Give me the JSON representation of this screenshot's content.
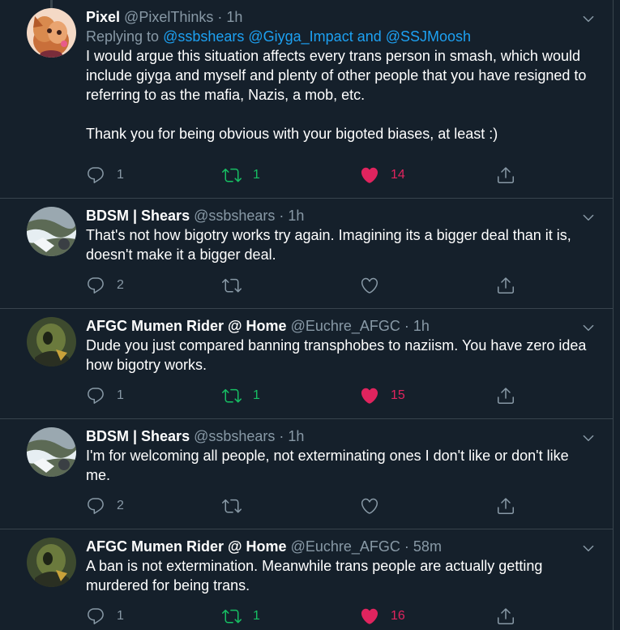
{
  "tweets": [
    {
      "name": "Pixel",
      "handle": "@PixelThinks",
      "time": "1h",
      "replying_prefix": "Replying to ",
      "replying_mentions": "@ssbshears @Giyga_Impact and @SSJMoosh",
      "text": "I would argue this situation affects every trans person in smash, which would include giyga and myself and plenty of other people that you have resigned to referring to as the mafia, Nazis, a mob, etc.\n\nThank you for being obvious with your bigoted biases, at least :)",
      "replies": "1",
      "retweets": "1",
      "retweeted": true,
      "likes": "14",
      "liked": true
    },
    {
      "name": "BDSM | Shears",
      "handle": "@ssbshears",
      "time": "1h",
      "text": "That's not how bigotry works try again. Imagining its a bigger deal than it is, doesn't make it a bigger deal.",
      "replies": "2",
      "retweets": "",
      "retweeted": false,
      "likes": "",
      "liked": false
    },
    {
      "name": "AFGC Mumen Rider @ Home",
      "handle": "@Euchre_AFGC",
      "time": "1h",
      "text": "Dude you just compared banning transphobes to naziism. You have zero idea how bigotry works.",
      "replies": "1",
      "retweets": "1",
      "retweeted": true,
      "likes": "15",
      "liked": true
    },
    {
      "name": "BDSM | Shears",
      "handle": "@ssbshears",
      "time": "1h",
      "text": "I'm for welcoming all people, not exterminating ones I don't like or don't like me.",
      "replies": "2",
      "retweets": "",
      "retweeted": false,
      "likes": "",
      "liked": false
    },
    {
      "name": "AFGC Mumen Rider @ Home",
      "handle": "@Euchre_AFGC",
      "time": "58m",
      "text": "A ban is not extermination. Meanwhile trans people are actually getting murdered for being trans.",
      "replies": "1",
      "retweets": "1",
      "retweeted": true,
      "likes": "16",
      "liked": true
    }
  ],
  "separator": " · ",
  "colors": {
    "background": "#15202b",
    "border": "#38444d",
    "muted": "#8899a6",
    "link": "#1da1f2",
    "retweet_active": "#17bf63",
    "like_active": "#e0245e"
  },
  "icons": {
    "reply": "reply-icon",
    "retweet": "retweet-icon",
    "like": "heart-icon",
    "share": "share-icon",
    "more": "chevron-down-icon"
  }
}
